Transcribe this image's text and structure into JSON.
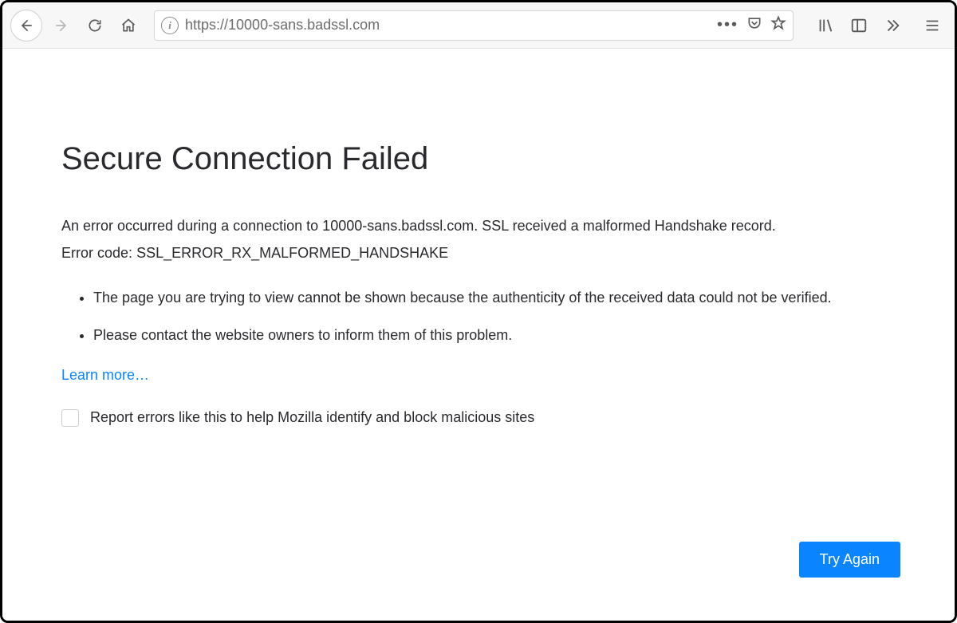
{
  "toolbar": {
    "url": "https://10000-sans.badssl.com"
  },
  "content": {
    "title": "Secure Connection Failed",
    "description": "An error occurred during a connection to 10000-sans.badssl.com. SSL received a malformed Handshake record.",
    "error_code_label": "Error code:",
    "error_code": "SSL_ERROR_RX_MALFORMED_HANDSHAKE",
    "bullets": [
      "The page you are trying to view cannot be shown because the authenticity of the received data could not be verified.",
      "Please contact the website owners to inform them of this problem."
    ],
    "learn_more": "Learn more…",
    "report_label": "Report errors like this to help Mozilla identify and block malicious sites",
    "try_again": "Try Again"
  }
}
